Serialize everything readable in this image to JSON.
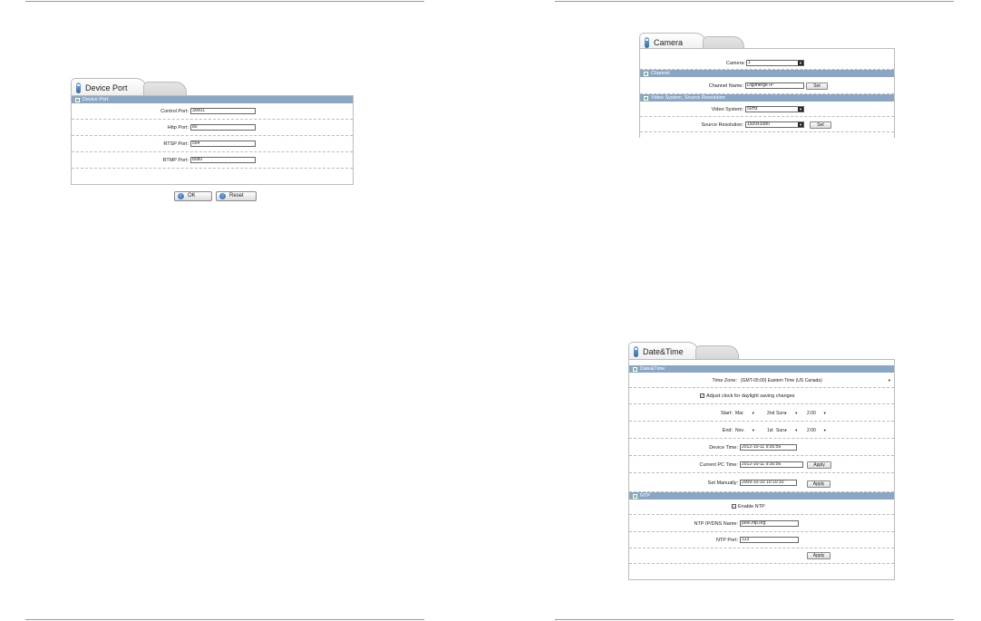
{
  "device_port": {
    "tab_title": "Device Port",
    "section": "Device Port",
    "fields": [
      {
        "label": "Control Port:",
        "value": "30001"
      },
      {
        "label": "Http Port:",
        "value": "80"
      },
      {
        "label": "RTSP Port:",
        "value": "554"
      },
      {
        "label": "RTMP Port:",
        "value": "8080"
      }
    ],
    "ok_label": "OK",
    "reset_label": "Reset"
  },
  "camera": {
    "tab_title": "Camera",
    "camera_label": "Camera:",
    "camera_value": "1",
    "channel_section": "Channel",
    "channel_name_label": "Channel Name:",
    "channel_name_value": "Digimerge IP",
    "set_label": "Set",
    "video_section": "Video System, Source Resolution",
    "video_system_label": "Video System:",
    "video_system_value": "50Hz",
    "source_resolution_label": "Source Resolution:",
    "source_resolution_value": "1920x1080"
  },
  "datetime": {
    "tab_title": "Date&Time",
    "section": "Date&Time",
    "time_zone_label": "Time Zone:",
    "time_zone_value": "(GMT-05:00) Eastern Time (US Canada)",
    "dst_label": "Adjust clock for daylight saving changes",
    "start_label": "Start:",
    "start": [
      "Mar.",
      "2nd",
      "Sun.",
      "2:00"
    ],
    "end_label": "End:",
    "end": [
      "Nov.",
      "1st",
      "Sun.",
      "2:00"
    ],
    "device_time_label": "Device Time:",
    "device_time_value": "2012-10-11 9:30:56",
    "current_pc_label": "Current PC Time:",
    "current_pc_value": "2012-10-11 9:30:56",
    "set_manually_label": "Set Manually:",
    "set_manually_value": "2009-10-10 10:10:10",
    "apply_label": "Apply",
    "ntp_section": "NTP",
    "enable_ntp_label": "Enable NTP",
    "ntp_name_label": "NTP IP/DNS Name:",
    "ntp_name_value": "pool.ntp.org",
    "ntp_port_label": "NTP Port:",
    "ntp_port_value": "123"
  }
}
